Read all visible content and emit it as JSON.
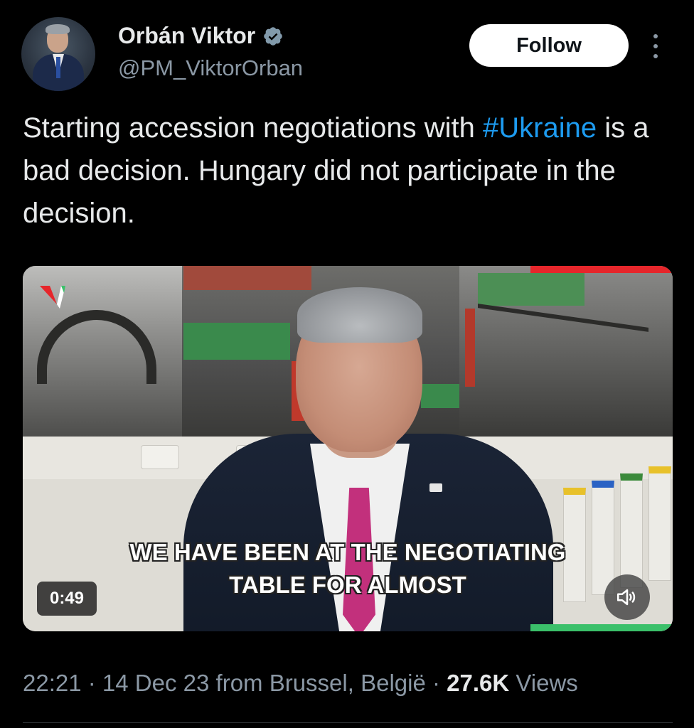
{
  "author": {
    "display_name": "Orbán Viktor",
    "handle": "@PM_ViktorOrban",
    "verified": true
  },
  "follow_label": "Follow",
  "tweet": {
    "text_before": "Starting accession negotiations with ",
    "hashtag": "#Ukraine",
    "text_after": " is a bad decision. Hungary did not participate in the decision."
  },
  "video": {
    "subtitle_line1": "WE HAVE BEEN AT THE NEGOTIATING",
    "subtitle_line2": "TABLE FOR ALMOST",
    "duration": "0:49",
    "muted": true
  },
  "meta": {
    "time": "22:21",
    "date": "14 Dec 23",
    "location": "from Brussel, België",
    "views_count": "27.6K",
    "views_label": "Views"
  },
  "colors": {
    "background": "#000000",
    "link": "#1d9bf0",
    "verified": "#829aab",
    "secondary_text": "#8b98a5"
  }
}
